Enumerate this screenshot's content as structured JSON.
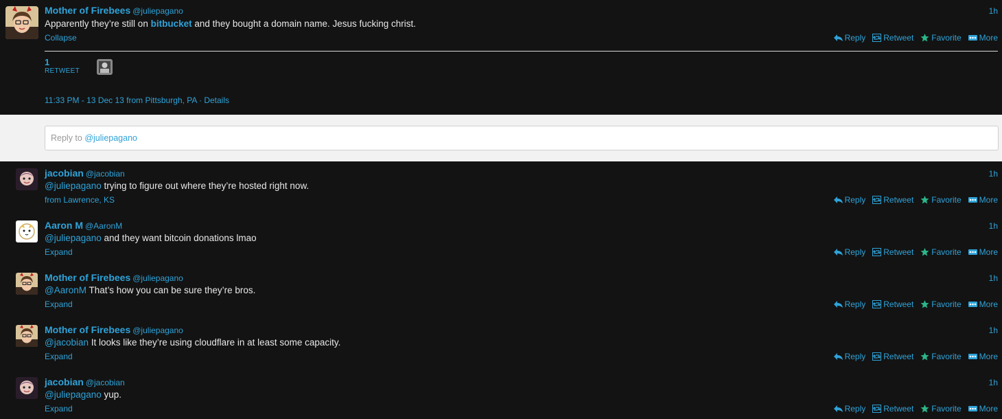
{
  "main_tweet": {
    "name": "Mother of Firebees",
    "handle": "@juliepagano",
    "time": "1h",
    "text_before": "Apparently they’re still on ",
    "text_link": "bitbucket",
    "text_after": " and they bought a domain name. Jesus fucking christ.",
    "collapse": "Collapse",
    "retweet_count": "1",
    "retweet_label": "RETWEET",
    "meta": "11:33 PM - 13 Dec 13 from Pittsburgh, PA · Details"
  },
  "reply_box": {
    "prefix": "Reply to ",
    "mention": "@juliepagano"
  },
  "actions": {
    "reply": "Reply",
    "retweet": "Retweet",
    "favorite": "Favorite",
    "more": "More"
  },
  "replies": [
    {
      "name": "jacobian",
      "handle": "@jacobian",
      "time": "1h",
      "mention": "@juliepagano",
      "text": " trying to figure out where they’re hosted right now.",
      "sub": "from Lawrence, KS"
    },
    {
      "name": "Aaron M",
      "handle": "@AaronM",
      "time": "1h",
      "mention": "@juliepagano",
      "text": " and they want bitcoin donations lmao",
      "sub": "Expand"
    },
    {
      "name": "Mother of Firebees",
      "handle": "@juliepagano",
      "time": "1h",
      "mention": "@AaronM",
      "text": " That’s how you can be sure they’re bros.",
      "sub": "Expand"
    },
    {
      "name": "Mother of Firebees",
      "handle": "@juliepagano",
      "time": "1h",
      "mention": "@jacobian",
      "text": " It looks like they’re using cloudflare in at least some capacity.",
      "sub": "Expand"
    },
    {
      "name": "jacobian",
      "handle": "@jacobian",
      "time": "1h",
      "mention": "@juliepagano",
      "text": " yup.",
      "sub": "Expand"
    }
  ],
  "colors": {
    "background": "#131313",
    "accent": "#2fa3d9",
    "reply_band": "#f2f2f2",
    "favorite_icon": "#2db58a"
  }
}
